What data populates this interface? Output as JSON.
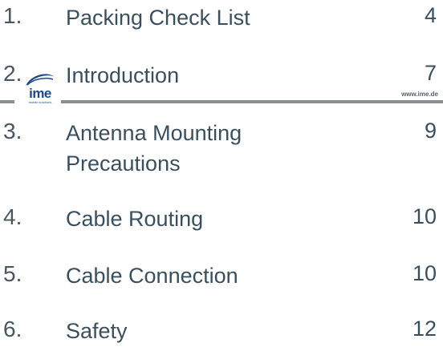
{
  "header": {
    "logo_text": "ime",
    "logo_tagline": "mobile solutions",
    "url": "www.ime.de"
  },
  "toc": [
    {
      "number": "1.",
      "title": "Packing Check List",
      "page": "4"
    },
    {
      "number": "2.",
      "title": "Introduction",
      "page": "7"
    },
    {
      "number": "3.",
      "title_line1": "Antenna Mounting",
      "title_line2": "Precautions",
      "page": "9"
    },
    {
      "number": "4.",
      "title": "Cable Routing",
      "page": "10"
    },
    {
      "number": "5.",
      "title": "Cable Connection",
      "page": "10"
    },
    {
      "number": "6.",
      "title": "Safety",
      "page": "12"
    }
  ],
  "colors": {
    "text": "#3a4f5e",
    "rule": "#8a8f94",
    "logo": "#1b4a8d"
  }
}
